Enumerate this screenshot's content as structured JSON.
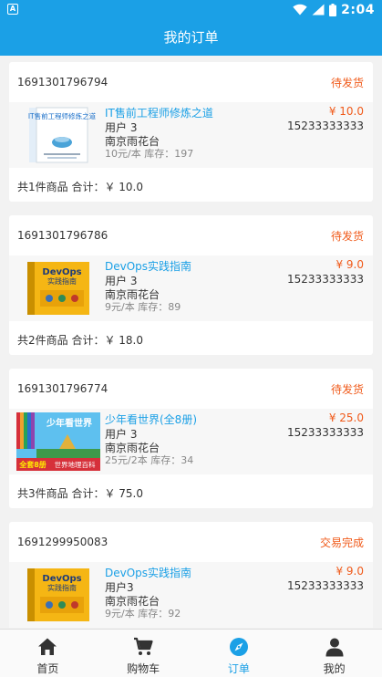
{
  "status_bar": {
    "app_icon": "A",
    "time": "2:04"
  },
  "header": {
    "title": "我的订单"
  },
  "orders": [
    {
      "order_no": "1691301796794",
      "status": "待发货",
      "item": {
        "name": "IT售前工程师修炼之道",
        "price": "¥ 10.0",
        "user": "用户 3",
        "phone": "15233333333",
        "address": "南京雨花台",
        "stock": "10元/本 库存：197"
      },
      "summary": "共1件商品 合计：￥ 10.0"
    },
    {
      "order_no": "1691301796786",
      "status": "待发货",
      "item": {
        "name": "DevOps实践指南",
        "price": "¥ 9.0",
        "user": "用户 3",
        "phone": "15233333333",
        "address": "南京雨花台",
        "stock": "9元/本 库存：89"
      },
      "summary": "共2件商品 合计：￥ 18.0"
    },
    {
      "order_no": "1691301796774",
      "status": "待发货",
      "item": {
        "name": "少年看世界(全8册)",
        "price": "¥ 25.0",
        "user": "用户 3",
        "phone": "15233333333",
        "address": "南京雨花台",
        "stock": "25元/2本 库存：34"
      },
      "summary": "共3件商品 合计：￥ 75.0"
    },
    {
      "order_no": "1691299950083",
      "status": "交易完成",
      "item": {
        "name": "DevOps实践指南",
        "price": "¥ 9.0",
        "user": "用户3",
        "phone": "15233333333",
        "address": "南京雨花台",
        "stock": "9元/本 库存：92"
      }
    }
  ],
  "book_cover_text": {
    "it": "IT售前工程师修炼之道",
    "devops_title": "DevOps",
    "devops_sub": "实践指南",
    "world_title": "少年看世界",
    "world_badge": "全套8册",
    "world_sub": "世界地理百科"
  },
  "tabs": [
    {
      "label": "首页",
      "icon": "home-icon"
    },
    {
      "label": "购物车",
      "icon": "cart-icon"
    },
    {
      "label": "订单",
      "icon": "compass-icon",
      "active": true
    },
    {
      "label": "我的",
      "icon": "person-icon"
    }
  ],
  "colors": {
    "primary": "#1ba0e6",
    "accent": "#f05a1a",
    "background": "#f2f2f2"
  }
}
